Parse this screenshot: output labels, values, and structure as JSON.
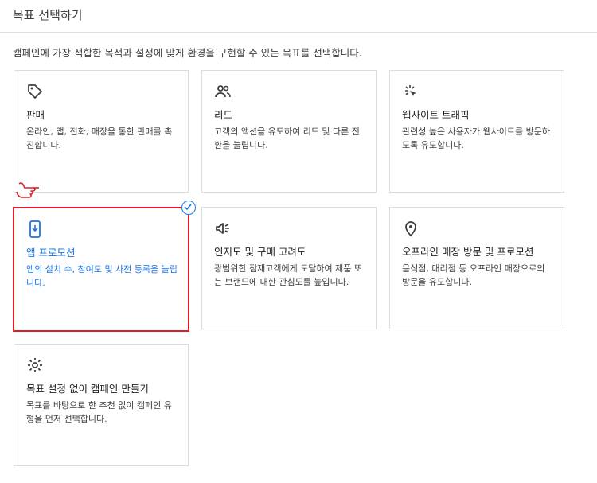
{
  "header": {
    "title": "목표 선택하기"
  },
  "description": "캠페인에 가장 적합한 목적과 설정에 맞게 환경을 구현할 수 있는 목표를 선택합니다.",
  "cards": [
    {
      "title": "판매",
      "desc": "온라인, 앱, 전화, 매장을 통한 판매를 촉진합니다.",
      "icon": "tag-icon",
      "selected": false
    },
    {
      "title": "리드",
      "desc": "고객의 액션을 유도하여 리드 및 다른 전환을 늘립니다.",
      "icon": "people-icon",
      "selected": false
    },
    {
      "title": "웹사이트 트래픽",
      "desc": "관련성 높은 사용자가 웹사이트를 방문하도록 유도합니다.",
      "icon": "click-icon",
      "selected": false
    },
    {
      "title": "앱 프로모션",
      "desc": "앱의 설치 수, 참여도 및 사전 등록을 늘립니다.",
      "icon": "phone-download-icon",
      "selected": true
    },
    {
      "title": "인지도 및 구매 고려도",
      "desc": "광범위한 잠재고객에게 도달하여 제품 또는 브랜드에 대한 관심도를 높입니다.",
      "icon": "megaphone-icon",
      "selected": false
    },
    {
      "title": "오프라인 매장 방문 및 프로모션",
      "desc": "음식점, 대리점 등 오프라인 매장으로의 방문을 유도합니다.",
      "icon": "location-pin-icon",
      "selected": false
    },
    {
      "title": "목표 설정 없이 캠페인 만들기",
      "desc": "목표를 바탕으로 한 추천 없이 캠페인 유형을 먼저 선택합니다.",
      "icon": "gear-icon",
      "selected": false
    }
  ],
  "colors": {
    "accent": "#1a73e8",
    "highlight": "#e31e24",
    "border": "#dadce0"
  }
}
